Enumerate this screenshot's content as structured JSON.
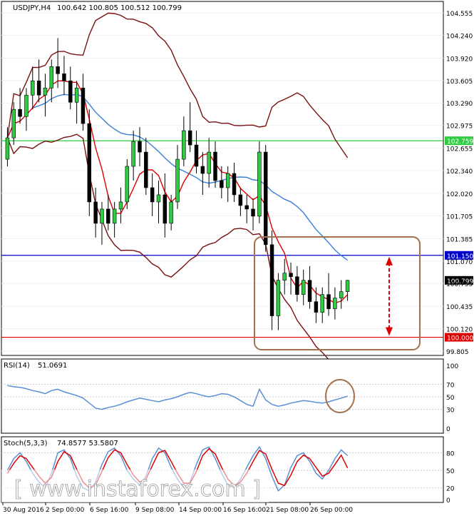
{
  "chart_data": [
    {
      "panel": "price",
      "type": "candlestick",
      "header": {
        "symbol": "USDJPY,H4",
        "values": [
          "100.642",
          "100.805",
          "100.512",
          "100.799"
        ]
      },
      "ylim": [
        99.805,
        104.555
      ],
      "y_ticks": [
        "104.555",
        "104.240",
        "103.920",
        "103.605",
        "103.290",
        "102.975",
        "102.655",
        "102.340",
        "102.020",
        "101.705",
        "101.385",
        "101.070",
        "100.755",
        "100.435",
        "100.120",
        "99.805"
      ],
      "levels": [
        {
          "label": "102.759",
          "value": 102.759,
          "color": "#2ecc40"
        },
        {
          "label": "101.150",
          "value": 101.15,
          "color": "#0000cc"
        },
        {
          "label": "100.000",
          "value": 100.0,
          "color": "#dd0000"
        }
      ],
      "last_price": {
        "label": "100.799",
        "value": 100.799
      },
      "x_labels": [
        "30 Aug 2016",
        "2 Sep 00:00",
        "6 Sep 16:00",
        "9 Sep 08:00",
        "14 Sep 00:00",
        "16 Sep 16:00",
        "21 Sep 08:00",
        "26 Sep 00:00"
      ],
      "candles": [
        [
          102.5,
          102.95,
          102.4,
          102.8
        ],
        [
          102.8,
          103.3,
          102.7,
          103.2
        ],
        [
          103.2,
          103.5,
          103.0,
          103.1
        ],
        [
          103.1,
          103.5,
          102.9,
          103.4
        ],
        [
          103.4,
          103.8,
          103.2,
          103.6
        ],
        [
          103.6,
          103.9,
          103.3,
          103.4
        ],
        [
          103.4,
          103.7,
          103.1,
          103.5
        ],
        [
          103.5,
          103.9,
          103.3,
          103.8
        ],
        [
          103.8,
          104.2,
          103.5,
          103.7
        ],
        [
          103.7,
          103.95,
          103.4,
          103.6
        ],
        [
          103.6,
          103.8,
          103.2,
          103.3
        ],
        [
          103.3,
          103.6,
          103.0,
          103.5
        ],
        [
          103.5,
          103.7,
          102.9,
          103.0
        ],
        [
          103.0,
          103.2,
          101.7,
          101.9
        ],
        [
          101.9,
          102.1,
          101.4,
          101.6
        ],
        [
          101.6,
          101.9,
          101.3,
          101.8
        ],
        [
          101.8,
          102.0,
          101.5,
          101.6
        ],
        [
          101.6,
          101.9,
          101.4,
          101.8
        ],
        [
          101.8,
          102.1,
          101.6,
          101.9
        ],
        [
          101.9,
          102.5,
          101.8,
          102.4
        ],
        [
          102.4,
          102.9,
          102.2,
          102.75
        ],
        [
          102.75,
          102.95,
          102.4,
          102.6
        ],
        [
          102.6,
          102.8,
          102.0,
          102.1
        ],
        [
          102.1,
          102.3,
          101.7,
          101.9
        ],
        [
          101.9,
          102.2,
          101.6,
          102.0
        ],
        [
          102.0,
          102.3,
          101.4,
          101.6
        ],
        [
          101.6,
          102.0,
          101.5,
          101.9
        ],
        [
          101.9,
          102.7,
          101.8,
          102.5
        ],
        [
          102.5,
          103.1,
          102.4,
          102.9
        ],
        [
          102.9,
          103.3,
          102.6,
          102.7
        ],
        [
          102.7,
          102.9,
          102.3,
          102.4
        ],
        [
          102.4,
          102.6,
          102.0,
          102.3
        ],
        [
          102.3,
          102.8,
          102.1,
          102.6
        ],
        [
          102.6,
          102.75,
          102.1,
          102.2
        ],
        [
          102.2,
          102.4,
          101.95,
          102.1
        ],
        [
          102.1,
          102.4,
          101.9,
          102.3
        ],
        [
          102.3,
          102.45,
          101.9,
          102.0
        ],
        [
          102.0,
          102.1,
          101.7,
          101.85
        ],
        [
          101.85,
          102.0,
          101.6,
          101.8
        ],
        [
          101.8,
          101.95,
          101.5,
          101.7
        ],
        [
          101.7,
          102.75,
          101.6,
          102.6
        ],
        [
          102.6,
          102.7,
          101.2,
          101.3
        ],
        [
          101.3,
          101.5,
          100.1,
          100.3
        ],
        [
          100.3,
          100.9,
          100.1,
          100.8
        ],
        [
          100.8,
          101.1,
          100.6,
          100.9
        ],
        [
          100.9,
          101.05,
          100.6,
          100.85
        ],
        [
          100.85,
          101.0,
          100.5,
          100.6
        ],
        [
          100.6,
          100.95,
          100.45,
          100.8
        ],
        [
          100.8,
          101.0,
          100.4,
          100.5
        ],
        [
          100.5,
          100.7,
          100.2,
          100.35
        ],
        [
          100.35,
          100.7,
          100.2,
          100.6
        ],
        [
          100.6,
          100.9,
          100.3,
          100.4
        ],
        [
          100.4,
          100.7,
          100.25,
          100.55
        ],
        [
          100.55,
          100.8,
          100.4,
          100.64
        ],
        [
          100.64,
          100.805,
          100.512,
          100.799
        ]
      ]
    },
    {
      "panel": "rsi",
      "type": "line",
      "header": {
        "name": "RSI(14)",
        "value": "51.0691"
      },
      "ylim": [
        0,
        100
      ],
      "y_ticks": [
        "100",
        "70",
        "50",
        "30",
        "0"
      ],
      "series": [
        {
          "color": "#5b8fd6",
          "values": [
            68,
            66,
            65,
            63,
            60,
            58,
            55,
            60,
            62,
            58,
            55,
            52,
            48,
            40,
            32,
            30,
            33,
            35,
            38,
            42,
            45,
            48,
            46,
            44,
            42,
            45,
            47,
            50,
            54,
            57,
            55,
            52,
            50,
            52,
            55,
            54,
            50,
            44,
            38,
            35,
            62,
            45,
            38,
            35,
            37,
            40,
            42,
            44,
            43,
            41,
            40,
            42,
            45,
            48,
            51
          ]
        }
      ]
    },
    {
      "panel": "stochastic",
      "type": "line",
      "header": {
        "name": "Stoch(5,3,3)",
        "values": [
          "74.8577",
          "53.5807"
        ]
      },
      "ylim": [
        0,
        100
      ],
      "y_ticks": [
        "80",
        "50",
        "20",
        "0"
      ],
      "series": [
        {
          "color": "#5b8fd6",
          "values": [
            50,
            70,
            80,
            65,
            45,
            30,
            20,
            45,
            80,
            85,
            70,
            40,
            20,
            15,
            30,
            60,
            82,
            88,
            75,
            50,
            35,
            25,
            40,
            70,
            88,
            80,
            55,
            35,
            20,
            30,
            60,
            85,
            90,
            70,
            45,
            25,
            20,
            35,
            55,
            75,
            90,
            70,
            40,
            15,
            25,
            55,
            75,
            80,
            65,
            45,
            35,
            50,
            70,
            85,
            75
          ]
        },
        {
          "color": "#dd0000",
          "values": [
            45,
            62,
            75,
            70,
            55,
            40,
            28,
            38,
            65,
            82,
            75,
            52,
            30,
            20,
            25,
            48,
            72,
            85,
            80,
            60,
            42,
            30,
            35,
            58,
            80,
            84,
            65,
            45,
            28,
            28,
            48,
            75,
            87,
            78,
            55,
            35,
            24,
            30,
            45,
            65,
            84,
            78,
            52,
            28,
            24,
            42,
            65,
            76,
            70,
            55,
            40,
            45,
            60,
            76,
            54
          ]
        }
      ]
    }
  ],
  "watermark": "[  www.instaforex.com  ]"
}
